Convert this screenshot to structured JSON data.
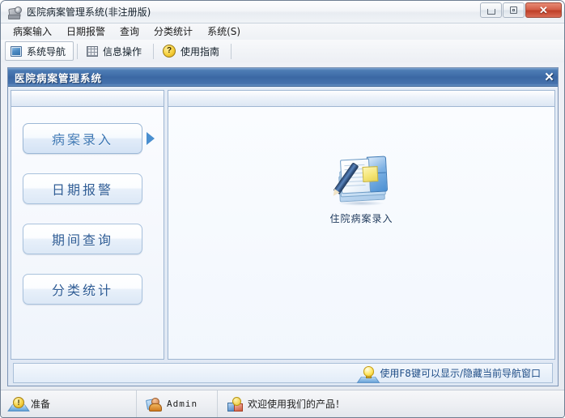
{
  "window": {
    "title": "医院病案管理系统(非注册版)",
    "icon": "camera-icon",
    "controls": {
      "minimize": "－",
      "maximize": "□",
      "close": "✕"
    }
  },
  "menubar": {
    "items": [
      {
        "label": "病案输入"
      },
      {
        "label": "日期报警"
      },
      {
        "label": "查询"
      },
      {
        "label": "分类统计"
      },
      {
        "label": "系统(S)"
      }
    ]
  },
  "toolbar": {
    "items": [
      {
        "label": "系统导航",
        "icon": "navigation-icon",
        "active": true
      },
      {
        "label": "信息操作",
        "icon": "grid-icon",
        "active": false
      },
      {
        "label": "使用指南",
        "icon": "help-icon",
        "active": false
      }
    ],
    "help_glyph": "?"
  },
  "child_window": {
    "title": "医院病案管理系统",
    "close_label": "✕"
  },
  "navigation": {
    "buttons": [
      {
        "label": "病案录入",
        "selected": true
      },
      {
        "label": "日期报警",
        "selected": false
      },
      {
        "label": "期间查询",
        "selected": false
      },
      {
        "label": "分类统计",
        "selected": false
      }
    ]
  },
  "content": {
    "tiles": [
      {
        "label": "住院病案录入",
        "icon": "notebook-pen-icon"
      }
    ]
  },
  "hint": {
    "icon": "lightbulb-icon",
    "text": "使用F8键可以显示/隐藏当前导航窗口"
  },
  "statusbar": {
    "cells": [
      {
        "icon": "ready-icon",
        "glyph": "!",
        "label": "准备"
      },
      {
        "icon": "user-icon",
        "label": "Admin",
        "mono": true
      },
      {
        "icon": "blocks-icon",
        "label": "欢迎使用我们的产品！"
      }
    ]
  },
  "colors": {
    "child_title_blue": "#3b68a4",
    "nav_text_blue": "#2f5d96",
    "selected_nav_text": "#3d77b4",
    "hint_text": "#1d4c86",
    "close_red": "#bf3f28"
  }
}
